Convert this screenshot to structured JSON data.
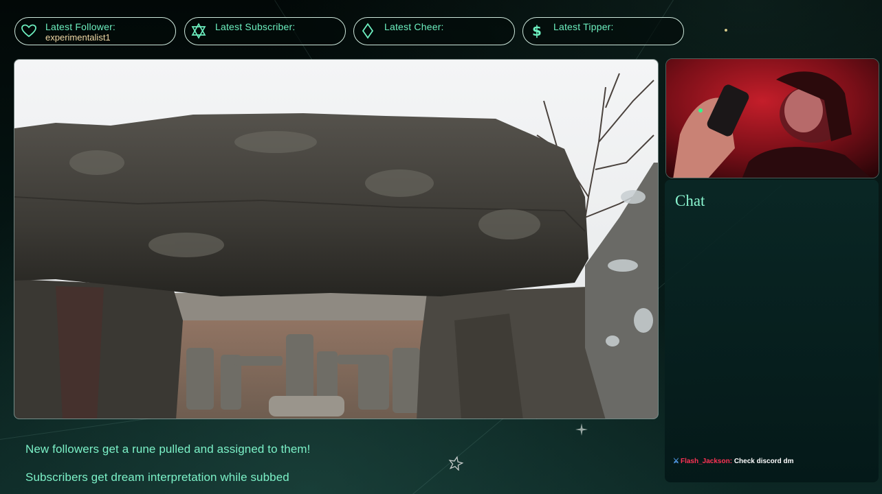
{
  "stats": [
    {
      "label": "Latest Follower:",
      "value": "experimentalist1",
      "icon": "heart-icon"
    },
    {
      "label": "Latest Subscriber:",
      "value": "",
      "icon": "star-of-david-icon"
    },
    {
      "label": "Latest Cheer:",
      "value": "",
      "icon": "diamond-icon"
    },
    {
      "label": "Latest Tipper:",
      "value": "",
      "icon": "dollar-icon"
    }
  ],
  "chat": {
    "title": "Chat",
    "messages": [
      {
        "username": "Flash_Jackson",
        "separator": ":",
        "text": "Check discord dm"
      }
    ]
  },
  "info": {
    "line1": "New followers get a rune pulled and assigned to them!",
    "line2": "Subscribers get dream interpretation while subbed"
  },
  "colors": {
    "accent": "#7cf2c8",
    "pill_border": "#cfe9dd",
    "value_text": "#f2d9a6",
    "chat_username": "#ff3355"
  }
}
